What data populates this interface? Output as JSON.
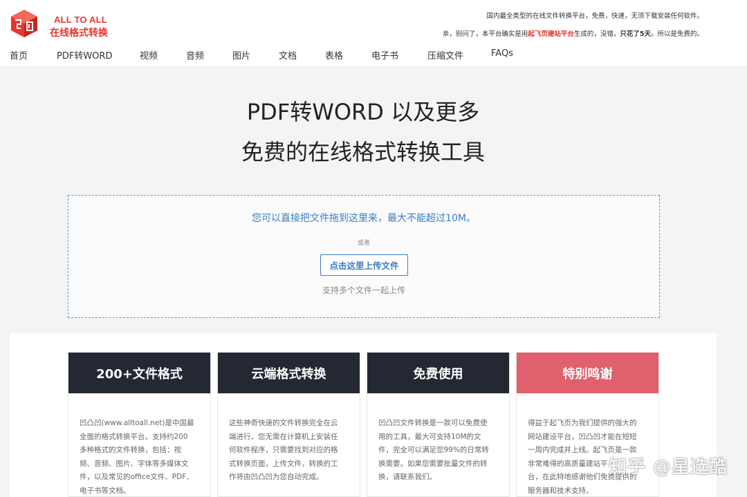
{
  "header": {
    "brand_en": "ALL TO ALL",
    "brand_cn": "在线格式转换",
    "notice1": "国内最全类型的在线文件转换平台，免费，快速，无须下载安装任何软件。",
    "notice2_pre": "亲，别问了，本平台确实是用",
    "notice2_link": "起飞页建站平台",
    "notice2_mid": "生成的，没错，",
    "notice2_bold": "只花了5天",
    "notice2_post": "。所以是免费的。"
  },
  "nav": [
    {
      "label": "首页"
    },
    {
      "label": "PDF转WORD"
    },
    {
      "label": "视频"
    },
    {
      "label": "音频"
    },
    {
      "label": "图片"
    },
    {
      "label": "文档"
    },
    {
      "label": "表格"
    },
    {
      "label": "电子书"
    },
    {
      "label": "压缩文件"
    },
    {
      "label": "FAQs"
    }
  ],
  "hero": {
    "line1": "PDF转WORD 以及更多",
    "line2": "免费的在线格式转换工具"
  },
  "upload": {
    "hint": "您可以直接把文件拖到这里来，最大不能超过10M。",
    "or": "或者",
    "button": "点击这里上传文件",
    "multi": "支持多个文件一起上传"
  },
  "features": [
    {
      "title": "200+文件格式",
      "lines": [
        "凹凸凹(www.alltoall.net)是中国最",
        "全面的格式转换平台。支持约200",
        "多种格式的文件转换，包括：视",
        "频、音频、图片、字体等多媒体文",
        "件，以及常见的office文件、PDF、",
        "电子书等文档。"
      ]
    },
    {
      "title": "云端格式转换",
      "lines": [
        "这些神奇快速的文件转换完全在云",
        "端进行，您无需在计算机上安装任",
        "何软件程序，只需要找到对应的格",
        "式转换页面，上传文件，转换的工",
        "作将由凹凸凹为您自动完成。"
      ]
    },
    {
      "title": "免费使用",
      "lines": [
        "凹凸凹文件转换是一款可以免费使",
        "用的工具，最大可支持10M的文",
        "件，完全可以满足您99%的日常转",
        "换需要。如果您需要批量文件的转",
        "换，请联系我们。"
      ]
    },
    {
      "title": "特别鸣谢",
      "lines": [
        "得益于起飞页为我们提供的强大的",
        "网站建设平台，凹凸凹才能在短短",
        "一周内完成并上线。起飞页是一款",
        "非常难得的高质量建站平",
        "台，在此特地感谢他们免费提供的",
        "服务器和技术支持。"
      ]
    }
  ],
  "watermark": "知乎 @星选酷",
  "colors": {
    "brand_red": "#e8362d",
    "link_blue": "#3a7cc4",
    "card_dark": "#232832",
    "card_pink": "#e0606e"
  }
}
